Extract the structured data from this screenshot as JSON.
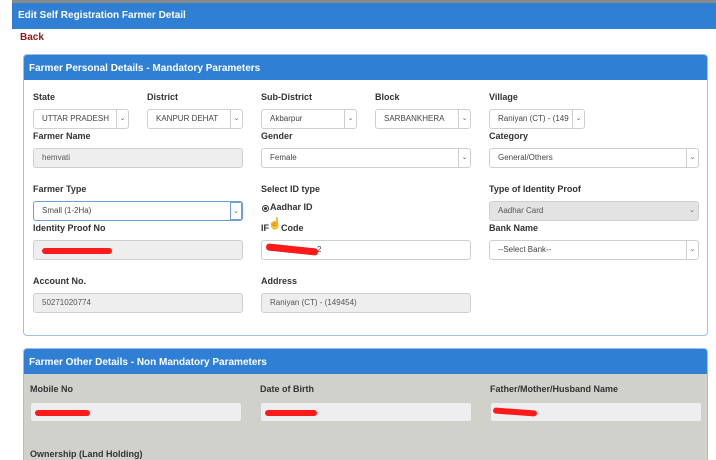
{
  "header": {
    "title": "Edit Self Registration Farmer Detail"
  },
  "back_label": "Back",
  "personal": {
    "heading": "Farmer Personal Details - Mandatory Parameters",
    "state": {
      "label": "State",
      "value": "UTTAR PRADESH"
    },
    "district": {
      "label": "District",
      "value": "KANPUR DEHAT"
    },
    "subdistrict": {
      "label": "Sub-District",
      "value": "Akbarpur"
    },
    "block": {
      "label": "Block",
      "value": "SARBANKHERA"
    },
    "village": {
      "label": "Village",
      "value": "Raniyan (CT) - (149"
    },
    "farmer_name": {
      "label": "Farmer Name",
      "value": "hemvati"
    },
    "gender": {
      "label": "Gender",
      "value": "Female"
    },
    "category": {
      "label": "Category",
      "value": "General/Others"
    },
    "farmer_type": {
      "label": "Farmer Type",
      "value": "Small (1-2Ha)"
    },
    "id_type": {
      "label": "Select ID type",
      "option": "Aadhar ID"
    },
    "identity_type": {
      "label": "Type of Identity Proof",
      "value": "Aadhar Card"
    },
    "identity_no": {
      "label": "Identity Proof No"
    },
    "ifsc": {
      "label_part1": "IF",
      "label_part2": "Code",
      "value_visible": "2"
    },
    "bank_name": {
      "label": "Bank Name",
      "value": "--Select Bank--"
    },
    "account_no": {
      "label": "Account No.",
      "value": "50271020774"
    },
    "address": {
      "label": "Address",
      "value": "Raniyan (CT)  -  (149454)"
    }
  },
  "other": {
    "heading": "Farmer Other Details - Non Mandatory Parameters",
    "mobile": {
      "label": "Mobile No"
    },
    "dob": {
      "label": "Date of Birth"
    },
    "relative": {
      "label": "Father/Mother/Husband Name"
    },
    "ownership": {
      "label": "Ownership (Land Holding)"
    }
  },
  "colors": {
    "header_blue": "#2f7fd4",
    "back_red": "#8b1a1a",
    "redaction": "#ff1a1a"
  }
}
